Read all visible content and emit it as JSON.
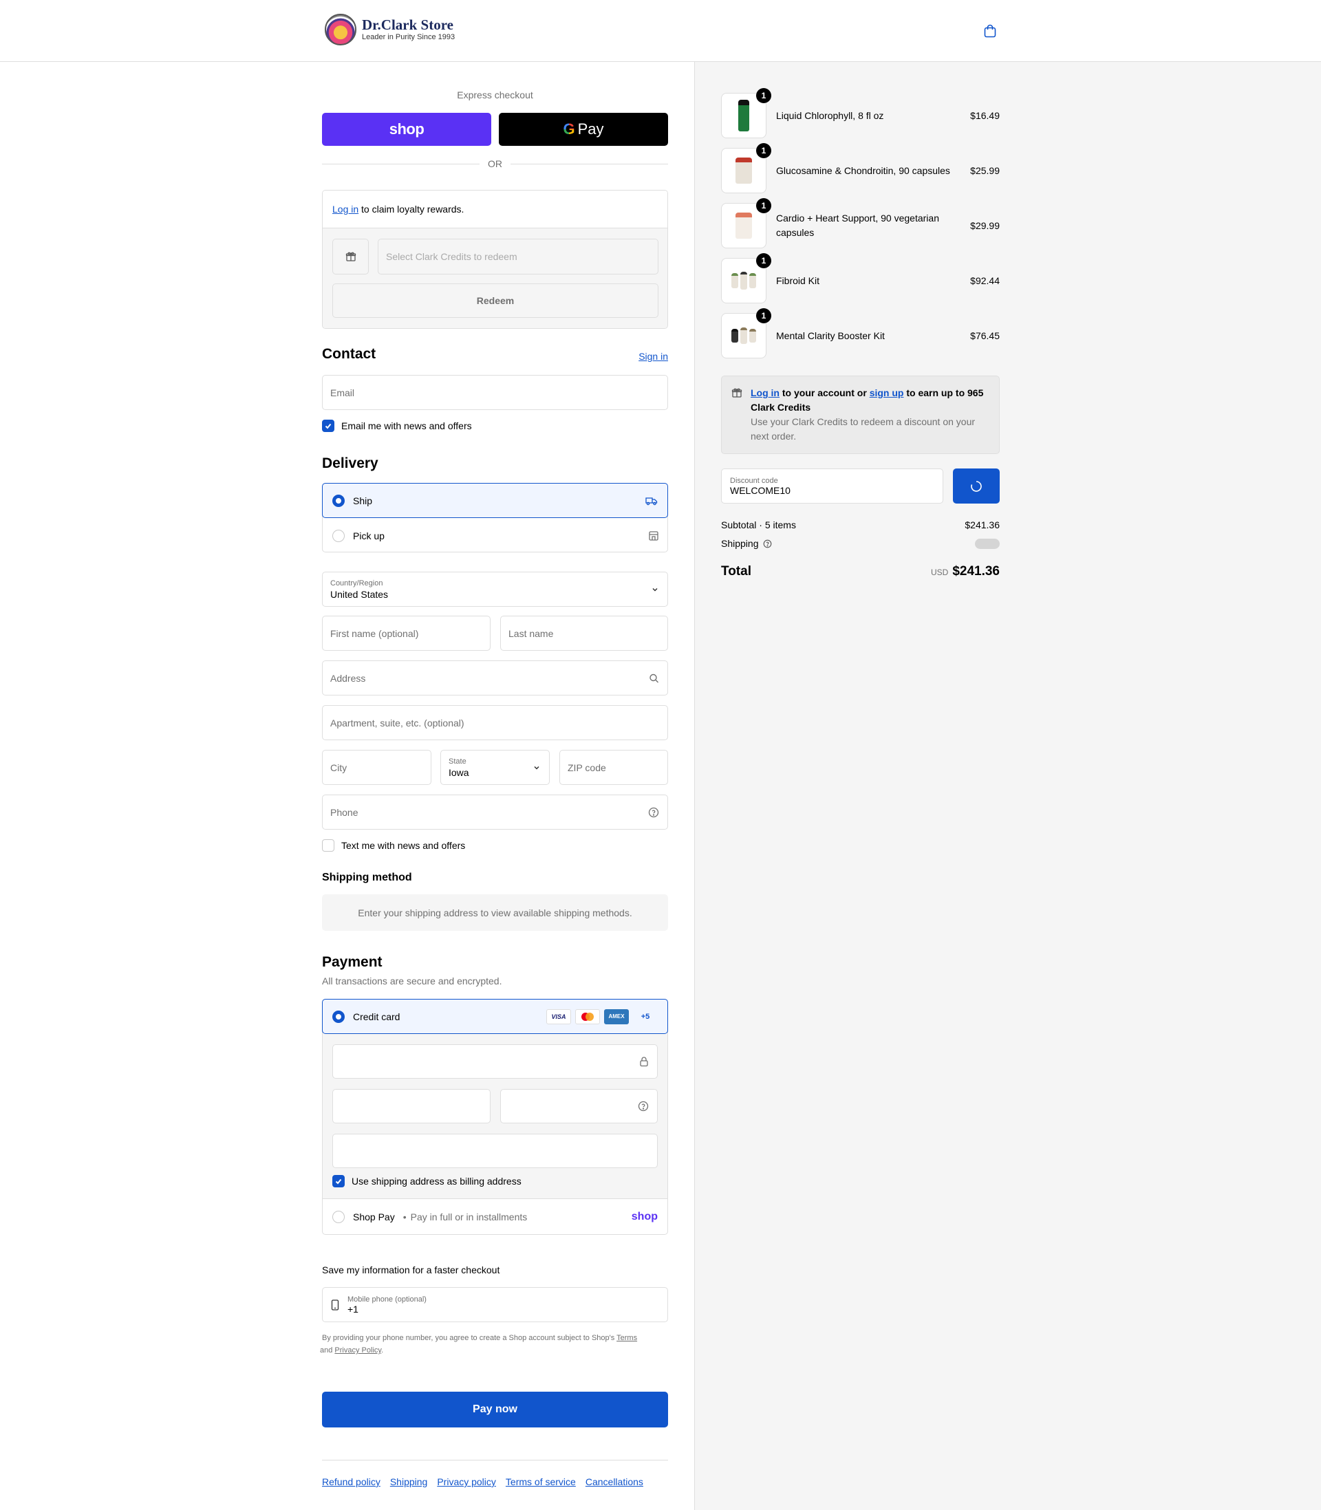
{
  "header": {
    "store_name": "Dr.Clark Store",
    "tagline": "Leader in Purity Since 1993",
    "cart_icon": "shopping-bag-icon"
  },
  "express": {
    "label": "Express checkout",
    "shop_pay": "shop",
    "google_pay_g": "G",
    "google_pay": "Pay",
    "or": "OR"
  },
  "loyalty": {
    "login_link": "Log in",
    "text": " to claim loyalty rewards.",
    "credits_placeholder": "Select Clark Credits to redeem",
    "redeem": "Redeem",
    "gift_icon": "gift-icon"
  },
  "contact": {
    "title": "Contact",
    "sign_in": "Sign in",
    "email_placeholder": "Email",
    "news_label": "Email me with news and offers",
    "news_checked": true
  },
  "delivery": {
    "title": "Delivery",
    "options": [
      {
        "label": "Ship",
        "selected": true,
        "icon": "truck-icon"
      },
      {
        "label": "Pick up",
        "selected": false,
        "icon": "store-icon"
      }
    ],
    "country_label": "Country/Region",
    "country_value": "United States",
    "first_name": "First name (optional)",
    "last_name": "Last name",
    "address": "Address",
    "apartment": "Apartment, suite, etc. (optional)",
    "city": "City",
    "state_label": "State",
    "state_value": "Iowa",
    "zip": "ZIP code",
    "phone": "Phone",
    "text_label": "Text me with news and offers",
    "text_checked": false
  },
  "shipping_method": {
    "title": "Shipping method",
    "note": "Enter your shipping address to view available shipping methods."
  },
  "payment": {
    "title": "Payment",
    "subtitle": "All transactions are secure and encrypted.",
    "credit_card": "Credit card",
    "cards": [
      "VISA",
      "mastercard",
      "AMEX"
    ],
    "more_cards": "+5",
    "billing_label": "Use shipping address as billing address",
    "billing_checked": true,
    "shop_pay": "Shop Pay",
    "shop_pay_sub": "Pay in full or in installments",
    "shop_pay_logo": "shop"
  },
  "save_info": {
    "title": "Save my information for a faster checkout",
    "mobile_label": "Mobile phone (optional)",
    "mobile_value": "+1",
    "legal_prefix": "By providing your phone number, you agree to create a Shop account subject to Shop's ",
    "legal_terms": "Terms",
    "legal_and": " and ",
    "legal_privacy": "Privacy Policy",
    "legal_suffix": "."
  },
  "pay_now": "Pay now",
  "footer": [
    "Refund policy",
    "Shipping",
    "Privacy policy",
    "Terms of service",
    "Cancellations"
  ],
  "summary": {
    "items": [
      {
        "name": "Liquid Chlorophyll, 8 fl oz",
        "price": "$16.49",
        "qty": "1",
        "color": "#1e7a3c"
      },
      {
        "name": "Glucosamine & Chondroitin, 90 capsules",
        "price": "$25.99",
        "qty": "1",
        "color": "#c0392b"
      },
      {
        "name": "Cardio + Heart Support, 90 vegetarian capsules",
        "price": "$29.99",
        "qty": "1",
        "color": "#e07a5f"
      },
      {
        "name": "Fibroid Kit",
        "price": "$92.44",
        "qty": "1",
        "color": "#6a8e4e"
      },
      {
        "name": "Mental Clarity Booster Kit",
        "price": "$76.45",
        "qty": "1",
        "color": "#8a7a5a"
      }
    ],
    "earn": {
      "login": "Log in",
      "mid": " to your account or ",
      "signup": "sign up",
      "after": " to earn up to 965 Clark Credits",
      "sub": "Use your Clark Credits to redeem a discount on your next order."
    },
    "discount_label": "Discount code",
    "discount_value": "WELCOME10",
    "subtotal_label": "Subtotal · 5 items",
    "subtotal_value": "$241.36",
    "shipping_label": "Shipping",
    "total_label": "Total",
    "currency": "USD",
    "total_value": "$241.36"
  }
}
